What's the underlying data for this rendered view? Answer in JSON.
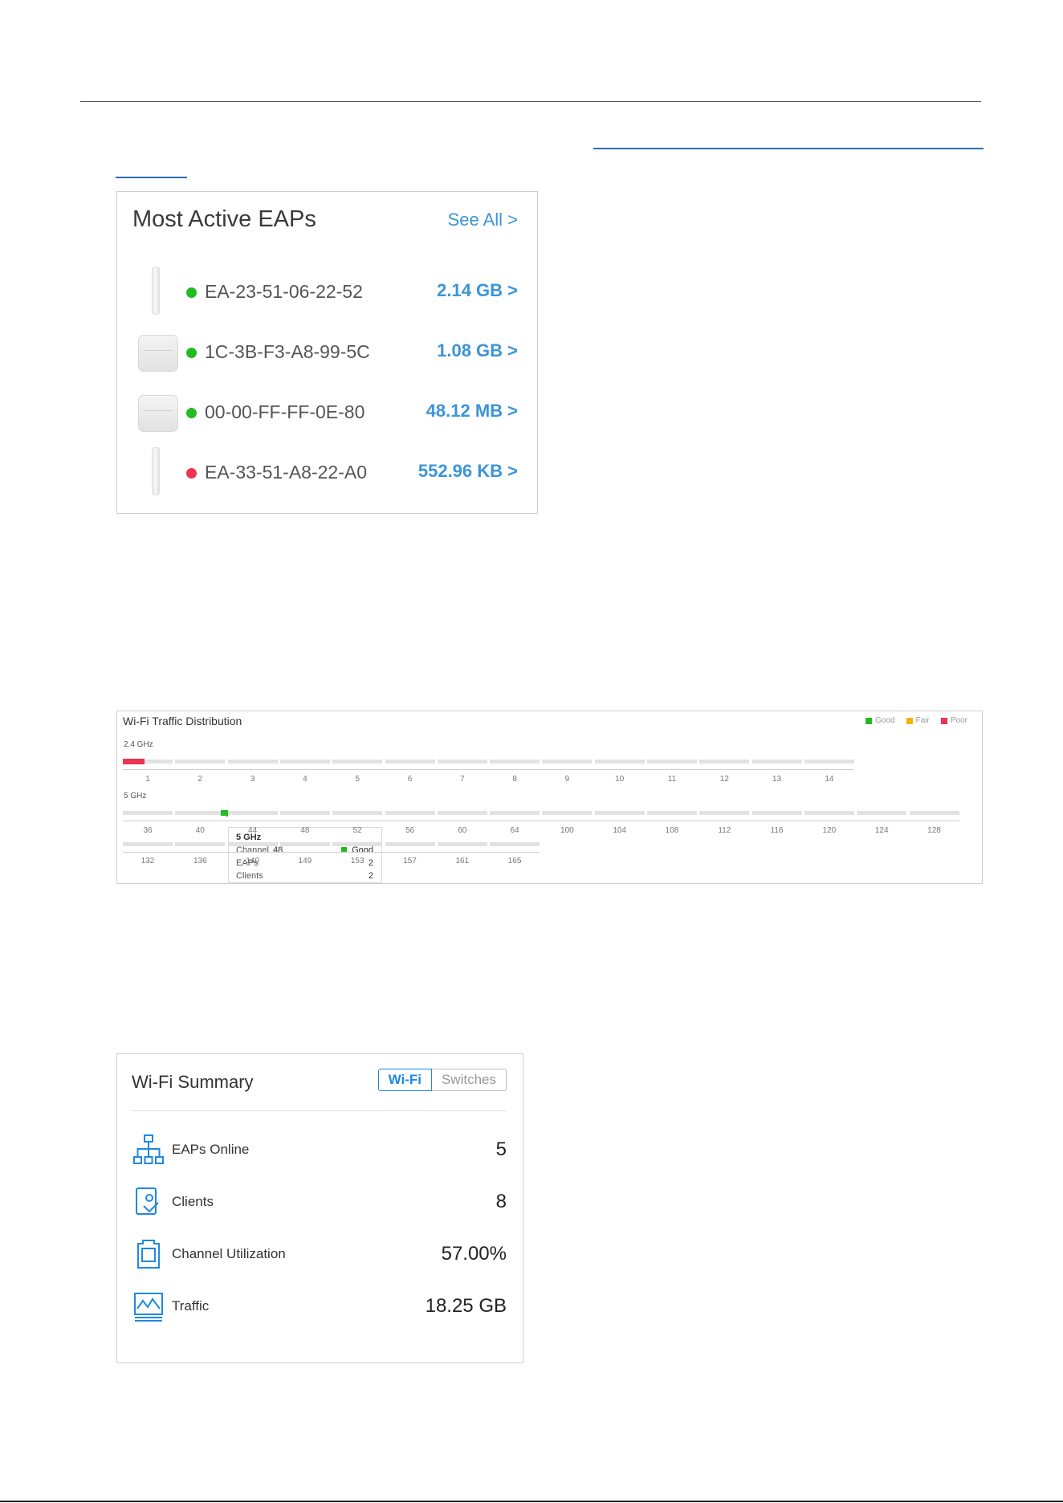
{
  "most_active_eaps": {
    "title": "Most Active EAPs",
    "see_all": "See All >",
    "rows": [
      {
        "device_icon": "wall-plate-ap-icon",
        "status_color": "#22bb22",
        "mac": "EA-23-51-06-22-52",
        "traffic": "2.14 GB >"
      },
      {
        "device_icon": "ceiling-ap-icon",
        "status_color": "#22bb22",
        "mac": "1C-3B-F3-A8-99-5C",
        "traffic": "1.08 GB >"
      },
      {
        "device_icon": "ceiling-ap-icon",
        "status_color": "#22bb22",
        "mac": "00-00-FF-FF-0E-80",
        "traffic": "48.12 MB >"
      },
      {
        "device_icon": "wall-plate-ap-icon",
        "status_color": "#ee3355",
        "mac": "EA-33-51-A8-22-A0",
        "traffic": "552.96 KB >"
      }
    ]
  },
  "traffic_distribution": {
    "title": "Wi-Fi Traffic Distribution",
    "legend": [
      {
        "label": "Good",
        "color": "#22bb22"
      },
      {
        "label": "Fair",
        "color": "#f0b400"
      },
      {
        "label": "Poor",
        "color": "#ee3355"
      }
    ],
    "band_24": {
      "label": "2.4 GHz",
      "channels": [
        "1",
        "2",
        "3",
        "4",
        "5",
        "6",
        "7",
        "8",
        "9",
        "10",
        "11",
        "12",
        "13",
        "14"
      ],
      "active": [
        {
          "channel": "1",
          "status": "Poor"
        }
      ]
    },
    "band_5": {
      "label": "5 GHz",
      "channels_row1": [
        "36",
        "40",
        "44",
        "48",
        "52",
        "56",
        "60",
        "64",
        "100",
        "104",
        "108",
        "112",
        "116",
        "120",
        "124",
        "128"
      ],
      "channels_row2": [
        "132",
        "136",
        "140",
        "149",
        "153",
        "157",
        "161",
        "165"
      ],
      "active": [
        {
          "channel": "40",
          "status": "Good"
        },
        {
          "channel": "48",
          "status": "Good"
        }
      ]
    },
    "tooltip": {
      "band": "5 GHz",
      "channel_label": "Channel",
      "channel_value": "48",
      "status": "Good",
      "eaps_label": "EAPs",
      "eaps_value": "2",
      "clients_label": "Clients",
      "clients_value": "2"
    }
  },
  "wifi_summary": {
    "title": "Wi-Fi Summary",
    "tabs": {
      "active": "Wi-Fi",
      "inactive": "Switches"
    },
    "rows": [
      {
        "icon": "network-tree-icon",
        "label": "EAPs Online",
        "value": "5"
      },
      {
        "icon": "client-device-icon",
        "label": "Clients",
        "value": "8"
      },
      {
        "icon": "channel-utilization-icon",
        "label": "Channel Utilization",
        "value": "57.00%"
      },
      {
        "icon": "traffic-chart-icon",
        "label": "Traffic",
        "value": "18.25 GB"
      }
    ],
    "accent": "#1e88e5"
  }
}
